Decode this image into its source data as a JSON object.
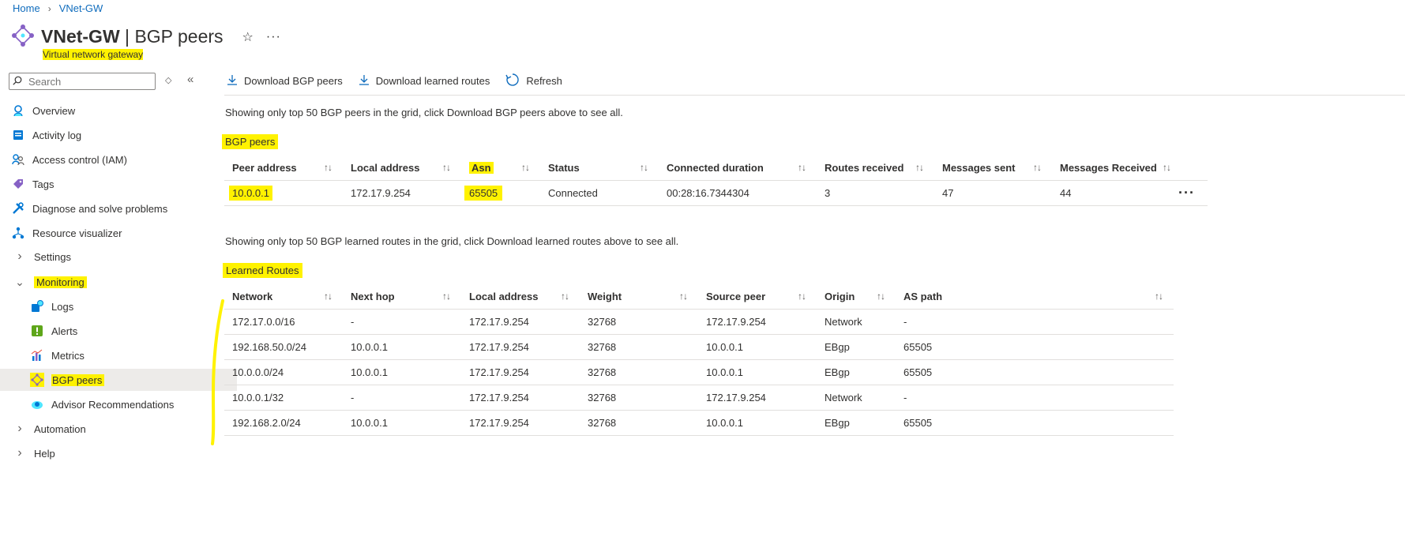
{
  "breadcrumb": {
    "home": "Home",
    "current": "VNet-GW"
  },
  "header": {
    "resource_name": "VNet-GW",
    "separator": " | ",
    "page_name": "BGP peers",
    "subtitle": "Virtual network gateway"
  },
  "search": {
    "placeholder": "Search"
  },
  "sidebar": {
    "items": [
      {
        "label": "Overview"
      },
      {
        "label": "Activity log"
      },
      {
        "label": "Access control (IAM)"
      },
      {
        "label": "Tags"
      },
      {
        "label": "Diagnose and solve problems"
      },
      {
        "label": "Resource visualizer"
      },
      {
        "label": "Settings"
      },
      {
        "label": "Monitoring"
      },
      {
        "label": "Logs"
      },
      {
        "label": "Alerts"
      },
      {
        "label": "Metrics"
      },
      {
        "label": "BGP peers"
      },
      {
        "label": "Advisor Recommendations"
      },
      {
        "label": "Automation"
      },
      {
        "label": "Help"
      }
    ]
  },
  "toolbar": {
    "download_peers": "Download BGP peers",
    "download_routes": "Download learned routes",
    "refresh": "Refresh"
  },
  "peers": {
    "info": "Showing only top 50 BGP peers in the grid, click Download BGP peers above to see all.",
    "title": "BGP peers",
    "columns": [
      "Peer address",
      "Local address",
      "Asn",
      "Status",
      "Connected duration",
      "Routes received",
      "Messages sent",
      "Messages Received"
    ],
    "rows": [
      [
        "10.0.0.1",
        "172.17.9.254",
        "65505",
        "Connected",
        "00:28:16.7344304",
        "3",
        "47",
        "44"
      ]
    ]
  },
  "routes": {
    "info": "Showing only top 50 BGP learned routes in the grid, click Download learned routes above to see all.",
    "title": "Learned Routes",
    "columns": [
      "Network",
      "Next hop",
      "Local address",
      "Weight",
      "Source peer",
      "Origin",
      "AS path"
    ],
    "rows": [
      [
        "172.17.0.0/16",
        "-",
        "172.17.9.254",
        "32768",
        "172.17.9.254",
        "Network",
        "-"
      ],
      [
        "192.168.50.0/24",
        "10.0.0.1",
        "172.17.9.254",
        "32768",
        "10.0.0.1",
        "EBgp",
        "65505"
      ],
      [
        "10.0.0.0/24",
        "10.0.0.1",
        "172.17.9.254",
        "32768",
        "10.0.0.1",
        "EBgp",
        "65505"
      ],
      [
        "10.0.0.1/32",
        "-",
        "172.17.9.254",
        "32768",
        "172.17.9.254",
        "Network",
        "-"
      ],
      [
        "192.168.2.0/24",
        "10.0.0.1",
        "172.17.9.254",
        "32768",
        "10.0.0.1",
        "EBgp",
        "65505"
      ]
    ]
  },
  "colors": {
    "accent": "#0f6cbd",
    "highlight": "#fff200",
    "border": "#e1dfdd",
    "selected": "#edebe9"
  },
  "icons": [
    "chevron-right-icon",
    "gateway-icon",
    "star-icon",
    "ellipsis-icon",
    "search-icon",
    "collapse-icon",
    "download-icon",
    "refresh-icon",
    "sort-icon"
  ]
}
